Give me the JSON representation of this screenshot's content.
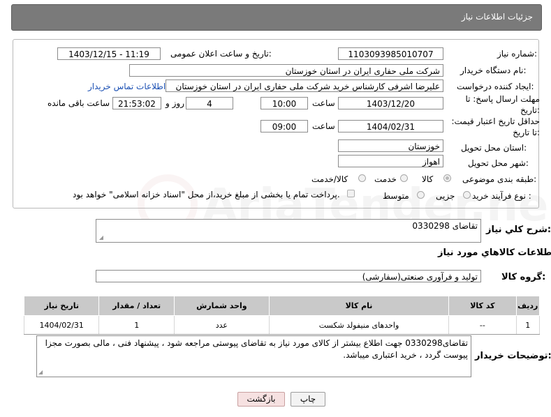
{
  "header": {
    "title": "جزئیات اطلاعات نیاز"
  },
  "labels": {
    "need_number": "شماره نیاز:",
    "announce_datetime": "تاریخ و ساعت اعلان عمومی:",
    "buyer_org": "نام دستگاه خریدار:",
    "creator": "ایجاد کننده درخواست:",
    "reply_deadline": "مهلت ارسال پاسخ: تا تاریخ:",
    "price_validity": "حداقل تاریخ اعتبار قیمت: تا تاریخ:",
    "time": "ساعت",
    "day_and": "روز و",
    "hours_remaining": "ساعت باقی مانده",
    "province": "استان محل تحویل:",
    "city": "شهر محل تحویل:",
    "category": "طبقه بندی موضوعی:",
    "process_type": "نوع فرآیند خرید :",
    "general_desc": "شرح کلي نياز:",
    "goods_info": "اطلاعات کالاهاي مورد نياز",
    "goods_group": "گروه کالا:",
    "buyer_notes": "توضیحات خریدار:"
  },
  "fields": {
    "need_number": "1103093985010707",
    "announce_datetime": "1403/12/15 - 11:19",
    "buyer_org": "شرکت ملی حفاری ایران در استان خوزستان",
    "creator": "علیرضا اشرفی کارشناس خرید شرکت ملی حفاری ایران در استان خوزستان",
    "contact_link": "اطلاعات تماس خریدار",
    "reply_date": "1403/12/20",
    "reply_time": "10:00",
    "days": "4",
    "remaining": "21:53:02",
    "validity_date": "1404/02/31",
    "validity_time": "09:00",
    "province": "خوزستان",
    "city": "اهواز",
    "general_desc": "تقاضای 0330298",
    "goods_group": "تولید و فرآوری صنعتی(سفارشی)",
    "buyer_notes": "تقاضای0330298 جهت اطلاع بیشتر از کالای مورد نیاز به تقاضای پیوستی مراجعه شود ، پیشنهاد فنی ، مالی بصورت مجزا پیوست گردد ، خرید اعتباری میباشد."
  },
  "category_options": [
    "کالا",
    "خدمت",
    "کالا/خدمت"
  ],
  "category_selected": "کالا",
  "process_options": [
    "جزیی",
    "متوسط"
  ],
  "process_payment_note": "پرداخت تمام یا بخشی از مبلغ خرید،از محل \"اسناد خزانه اسلامی\" خواهد بود.",
  "table": {
    "headers": [
      "ردیف",
      "کد کالا",
      "نام کالا",
      "واحد شمارش",
      "تعداد / مقدار",
      "تاریخ نیاز"
    ],
    "rows": [
      [
        "1",
        "--",
        "واحدهای منیفولد شکست",
        "عدد",
        "1",
        "1404/02/31"
      ]
    ]
  },
  "buttons": {
    "print": "چاپ",
    "back": "بازگشت"
  },
  "watermark_text": "AriaTender.neT"
}
